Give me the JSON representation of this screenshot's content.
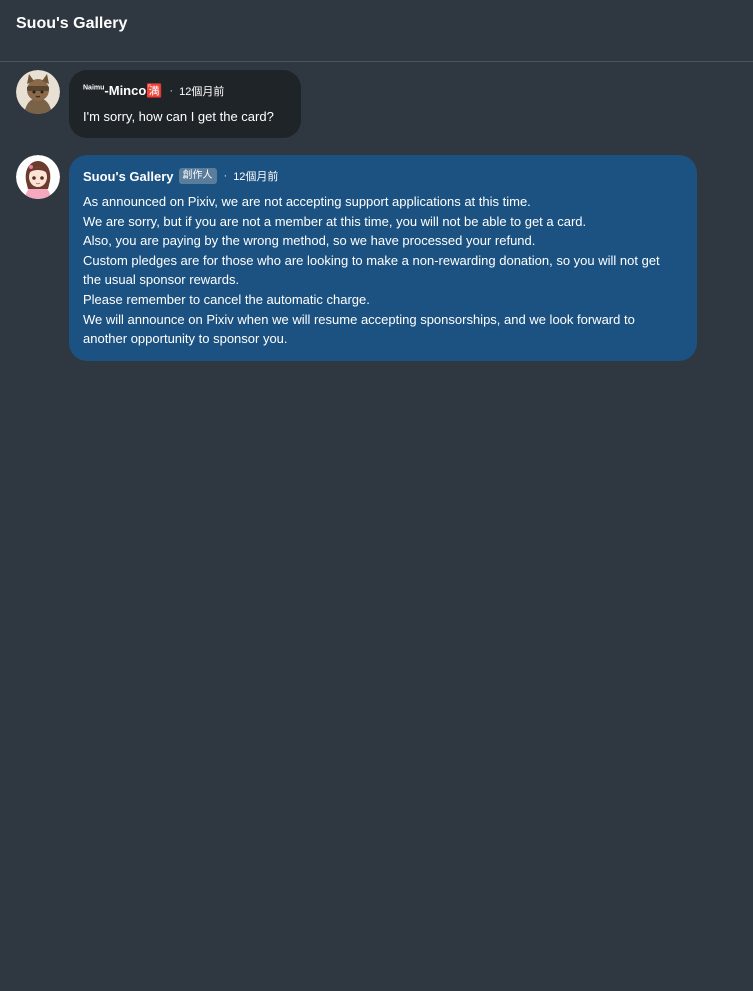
{
  "header": {
    "title": "Suou's Gallery"
  },
  "messages": [
    {
      "author_prefix": "Naimu",
      "author": "-Minco🈵",
      "dot": "·",
      "time": "12個月前",
      "lines": [
        "I'm sorry, how can I get the card?"
      ]
    },
    {
      "author": "Suou's Gallery",
      "badge": "創作人",
      "dot": "·",
      "time": "12個月前",
      "lines": [
        "As announced on Pixiv, we are not accepting support applications at this time.",
        "We are sorry, but if you are not a member at this time, you will not be able to get a card.",
        "Also, you are paying by the wrong method, so we have processed your refund.",
        "Custom pledges are for those who are looking to make a non-rewarding donation, so you will not get the usual sponsor rewards.",
        "Please remember to cancel the automatic charge.",
        "We will announce on Pixiv when we will resume accepting sponsorships, and we look forward to another opportunity to sponsor you."
      ]
    }
  ]
}
